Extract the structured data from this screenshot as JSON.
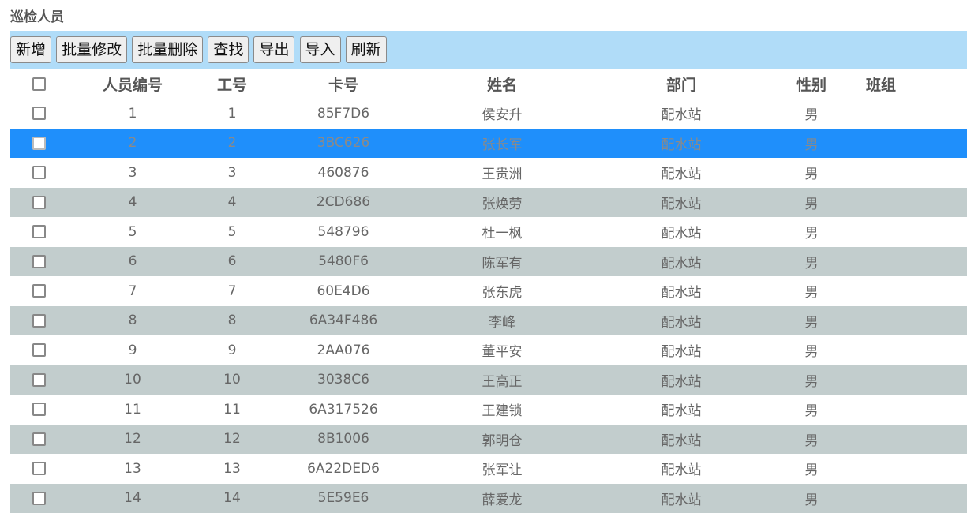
{
  "page": {
    "title": "巡检人员"
  },
  "toolbar": {
    "buttons": [
      "新增",
      "批量修改",
      "批量删除",
      "查找",
      "导出",
      "导入",
      "刷新"
    ]
  },
  "table": {
    "columns": [
      "人员编号",
      "工号",
      "卡号",
      "姓名",
      "部门",
      "性别",
      "班组"
    ],
    "selected_row": 1,
    "rows": [
      {
        "id": "1",
        "emp": "1",
        "card": "85F7D6",
        "name": "侯安升",
        "dept": "配水站",
        "sex": "男",
        "team": ""
      },
      {
        "id": "2",
        "emp": "2",
        "card": "3BC626",
        "name": "张长军",
        "dept": "配水站",
        "sex": "男",
        "team": ""
      },
      {
        "id": "3",
        "emp": "3",
        "card": "460876",
        "name": "王贵洲",
        "dept": "配水站",
        "sex": "男",
        "team": ""
      },
      {
        "id": "4",
        "emp": "4",
        "card": "2CD686",
        "name": "张焕劳",
        "dept": "配水站",
        "sex": "男",
        "team": ""
      },
      {
        "id": "5",
        "emp": "5",
        "card": "548796",
        "name": "杜一枫",
        "dept": "配水站",
        "sex": "男",
        "team": ""
      },
      {
        "id": "6",
        "emp": "6",
        "card": "5480F6",
        "name": "陈军有",
        "dept": "配水站",
        "sex": "男",
        "team": ""
      },
      {
        "id": "7",
        "emp": "7",
        "card": "60E4D6",
        "name": "张东虎",
        "dept": "配水站",
        "sex": "男",
        "team": ""
      },
      {
        "id": "8",
        "emp": "8",
        "card": "6A34F486",
        "name": "李峰",
        "dept": "配水站",
        "sex": "男",
        "team": ""
      },
      {
        "id": "9",
        "emp": "9",
        "card": "2AA076",
        "name": "董平安",
        "dept": "配水站",
        "sex": "男",
        "team": ""
      },
      {
        "id": "10",
        "emp": "10",
        "card": "3038C6",
        "name": "王高正",
        "dept": "配水站",
        "sex": "男",
        "team": ""
      },
      {
        "id": "11",
        "emp": "11",
        "card": "6A317526",
        "name": "王建锁",
        "dept": "配水站",
        "sex": "男",
        "team": ""
      },
      {
        "id": "12",
        "emp": "12",
        "card": "8B1006",
        "name": "郭明仓",
        "dept": "配水站",
        "sex": "男",
        "team": ""
      },
      {
        "id": "13",
        "emp": "13",
        "card": "6A22DED6",
        "name": "张军让",
        "dept": "配水站",
        "sex": "男",
        "team": ""
      },
      {
        "id": "14",
        "emp": "14",
        "card": "5E59E6",
        "name": "薛爱龙",
        "dept": "配水站",
        "sex": "男",
        "team": ""
      }
    ]
  },
  "colors": {
    "toolbar_bg": "#b0dcf8",
    "row_alt_bg": "#c2cdcd",
    "row_selected_bg": "#1f8ffb"
  }
}
